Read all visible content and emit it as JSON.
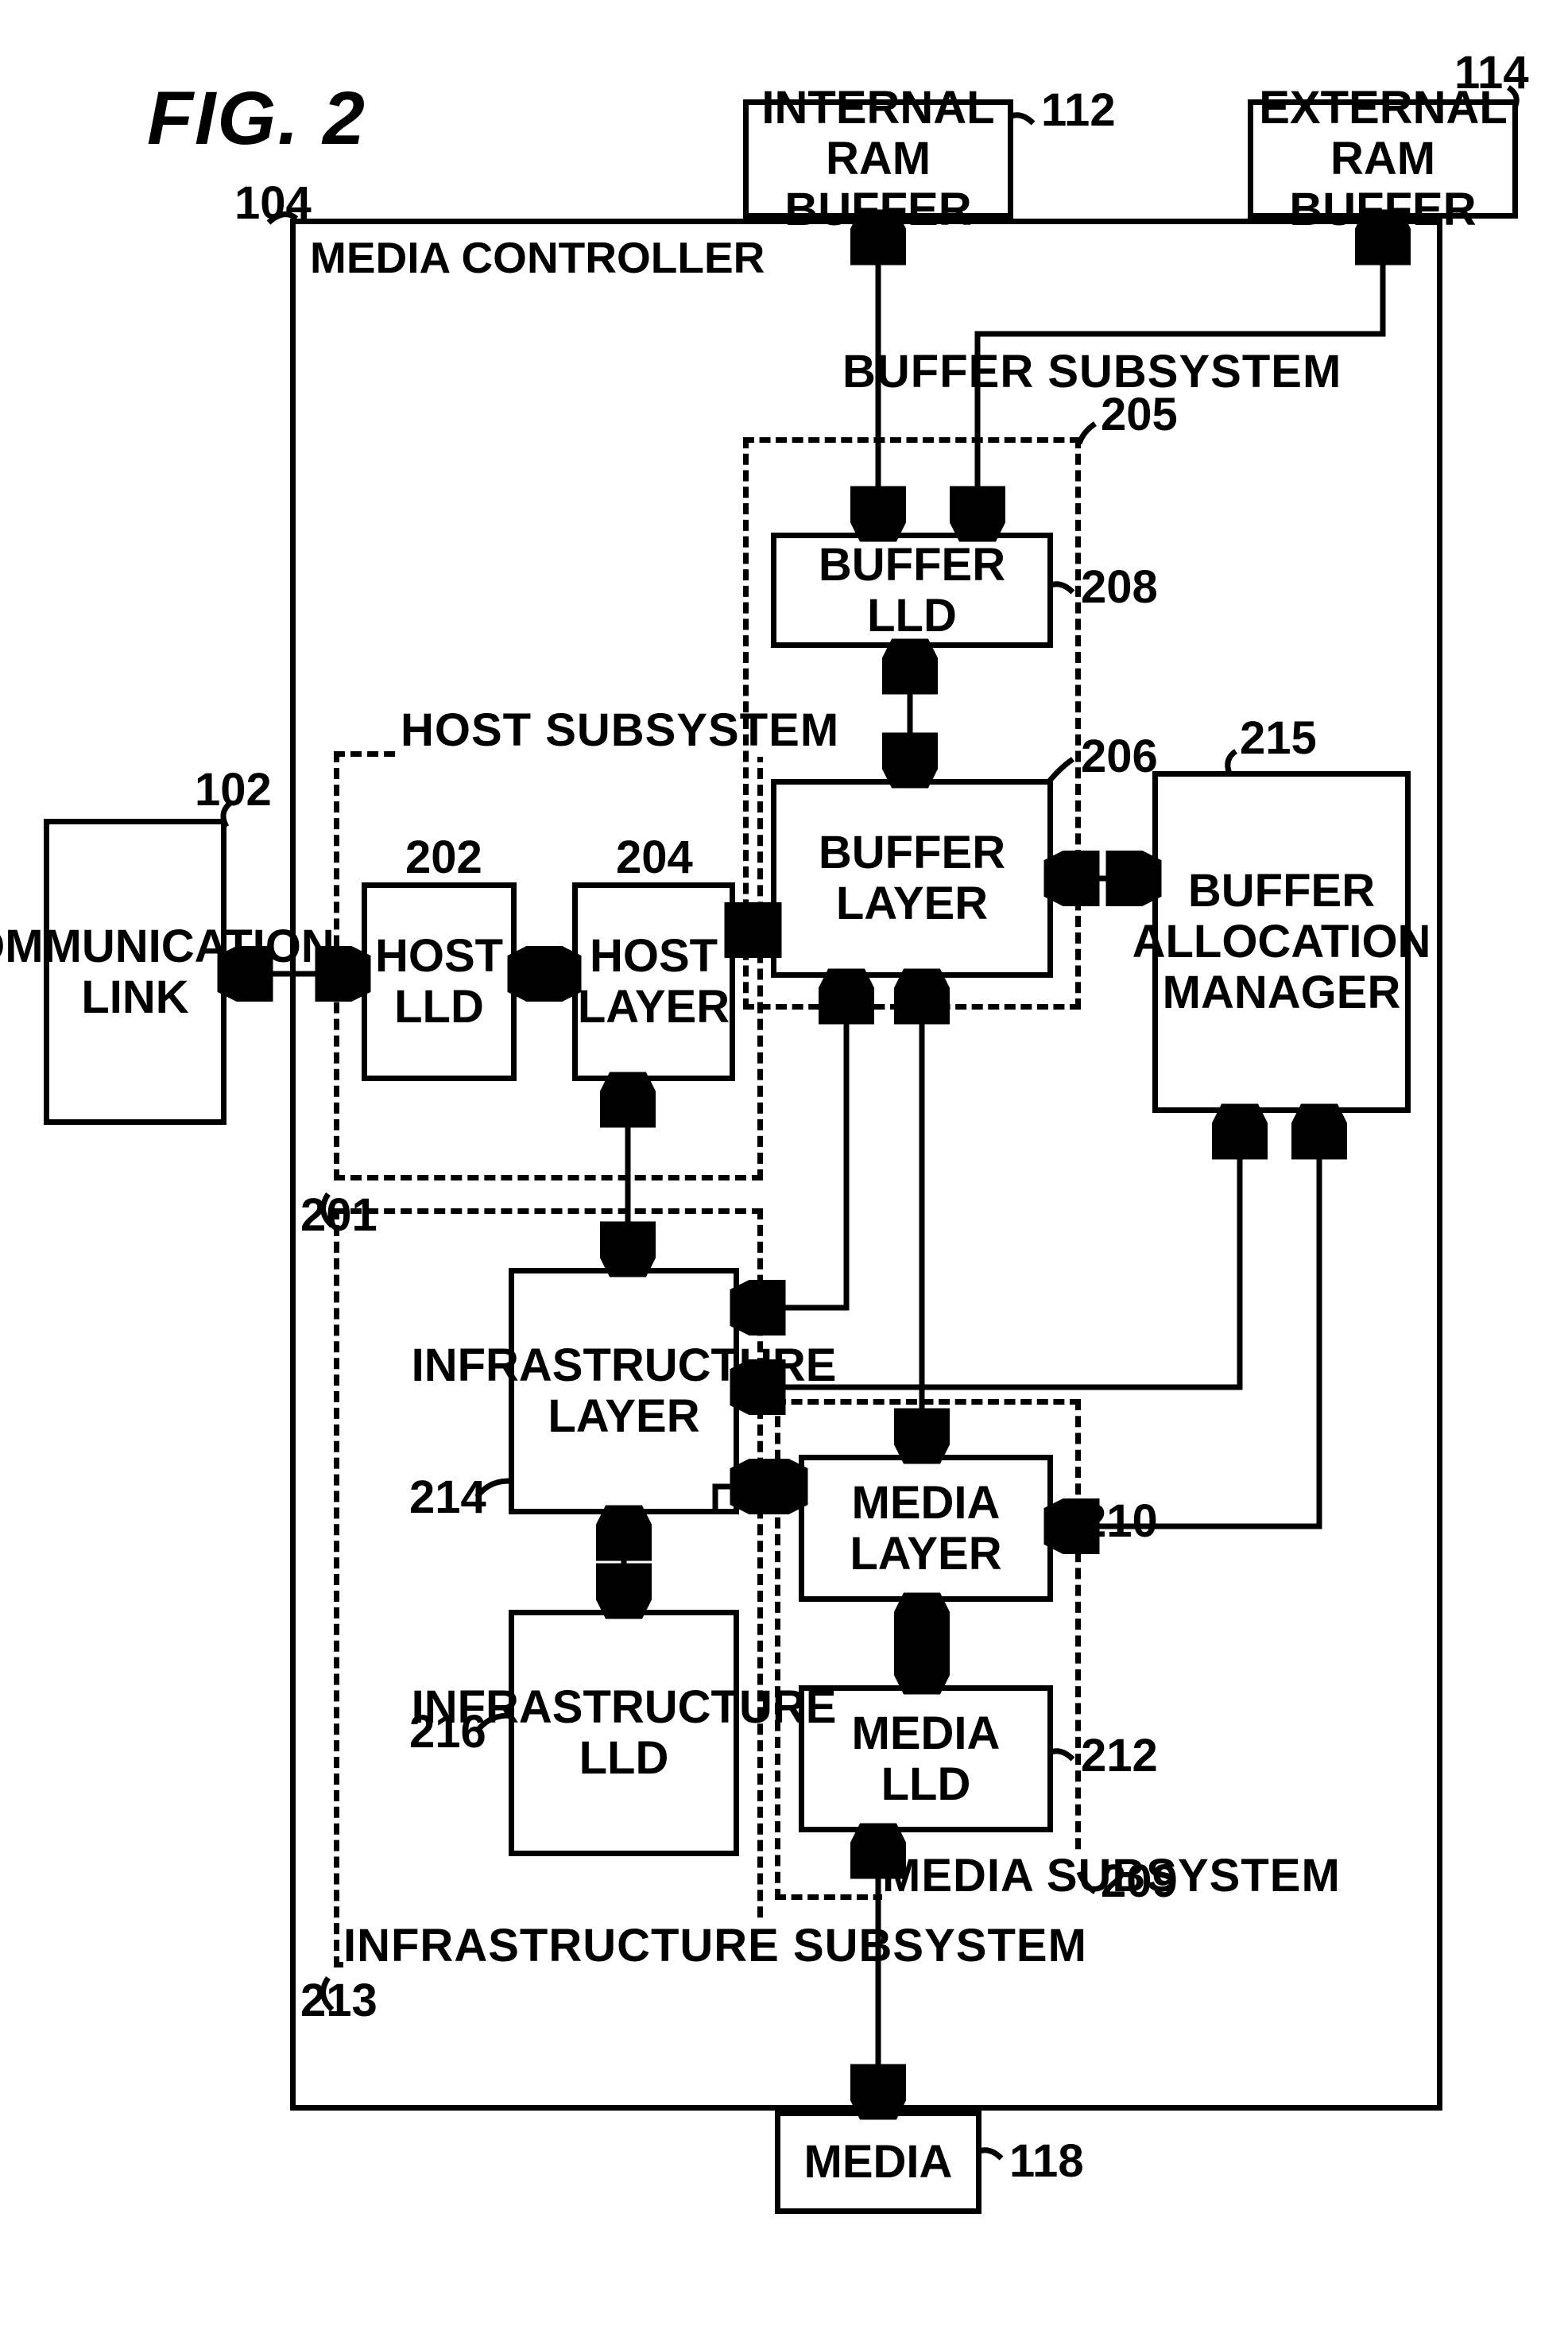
{
  "figure_title": "FIG. 2",
  "diagram": {
    "controller": {
      "label": "MEDIA CONTROLLER",
      "ref": "104"
    },
    "external_left": {
      "label": "COMMUNICATION LINK",
      "ref": "102"
    },
    "external_top_left": {
      "label": "INTERNAL RAM BUFFER",
      "ref": "112"
    },
    "external_top_right": {
      "label": "EXTERNAL RAM BUFFER",
      "ref": "114"
    },
    "external_bottom": {
      "label": "MEDIA",
      "ref": "118"
    },
    "subsystems": {
      "host": {
        "label": "HOST SUBSYSTEM",
        "ref": "201"
      },
      "buffer": {
        "label": "BUFFER SUBSYSTEM",
        "ref": "205"
      },
      "media": {
        "label": "MEDIA SUBSYSTEM",
        "ref": "209"
      },
      "infra": {
        "label": "INFRASTRUCTURE SUBSYSTEM",
        "ref": "213"
      }
    },
    "blocks": {
      "host_lld": {
        "label": "HOST LLD",
        "ref": "202"
      },
      "host_layer": {
        "label": "HOST LAYER",
        "ref": "204"
      },
      "buffer_lld": {
        "label": "BUFFER LLD",
        "ref": "208"
      },
      "buffer_layer": {
        "label": "BUFFER LAYER",
        "ref": "206"
      },
      "buffer_alloc": {
        "label": "BUFFER ALLOCATION MANAGER",
        "ref": "215"
      },
      "media_layer": {
        "label": "MEDIA LAYER",
        "ref": "210"
      },
      "media_lld": {
        "label": "MEDIA LLD",
        "ref": "212"
      },
      "infra_layer": {
        "label": "INFRASTRUCTURE LAYER",
        "ref": "214"
      },
      "infra_lld": {
        "label": "INFRASTRUCTURE LLD",
        "ref": "216"
      }
    }
  },
  "chart_data": {
    "type": "block-diagram",
    "title": "FIG. 2 — Media Controller architecture",
    "components": [
      {
        "id": "104",
        "name": "MEDIA CONTROLLER",
        "kind": "container"
      },
      {
        "id": "102",
        "name": "COMMUNICATION LINK",
        "kind": "external"
      },
      {
        "id": "112",
        "name": "INTERNAL RAM BUFFER",
        "kind": "external"
      },
      {
        "id": "114",
        "name": "EXTERNAL RAM BUFFER",
        "kind": "external"
      },
      {
        "id": "118",
        "name": "MEDIA",
        "kind": "external"
      },
      {
        "id": "201",
        "name": "HOST SUBSYSTEM",
        "kind": "subsystem"
      },
      {
        "id": "205",
        "name": "BUFFER SUBSYSTEM",
        "kind": "subsystem"
      },
      {
        "id": "209",
        "name": "MEDIA SUBSYSTEM",
        "kind": "subsystem"
      },
      {
        "id": "213",
        "name": "INFRASTRUCTURE SUBSYSTEM",
        "kind": "subsystem"
      },
      {
        "id": "202",
        "name": "HOST LLD",
        "kind": "block",
        "parent": "201"
      },
      {
        "id": "204",
        "name": "HOST LAYER",
        "kind": "block",
        "parent": "201"
      },
      {
        "id": "208",
        "name": "BUFFER LLD",
        "kind": "block",
        "parent": "205"
      },
      {
        "id": "206",
        "name": "BUFFER LAYER",
        "kind": "block",
        "parent": "205"
      },
      {
        "id": "215",
        "name": "BUFFER ALLOCATION MANAGER",
        "kind": "block"
      },
      {
        "id": "210",
        "name": "MEDIA LAYER",
        "kind": "block",
        "parent": "209"
      },
      {
        "id": "212",
        "name": "MEDIA LLD",
        "kind": "block",
        "parent": "209"
      },
      {
        "id": "214",
        "name": "INFRASTRUCTURE LAYER",
        "kind": "block",
        "parent": "213"
      },
      {
        "id": "216",
        "name": "INFRASTRUCTURE LLD",
        "kind": "block",
        "parent": "213"
      }
    ],
    "edges": [
      {
        "a": "102",
        "b": "202",
        "dir": "both"
      },
      {
        "a": "202",
        "b": "204",
        "dir": "both"
      },
      {
        "a": "204",
        "b": "206",
        "dir": "both"
      },
      {
        "a": "204",
        "b": "214",
        "dir": "both"
      },
      {
        "a": "206",
        "b": "208",
        "dir": "both"
      },
      {
        "a": "208",
        "b": "112",
        "dir": "both"
      },
      {
        "a": "208",
        "b": "114",
        "dir": "both",
        "via": "104-edge"
      },
      {
        "a": "206",
        "b": "215",
        "dir": "both"
      },
      {
        "a": "206",
        "b": "214",
        "dir": "both"
      },
      {
        "a": "206",
        "b": "210",
        "dir": "both"
      },
      {
        "a": "210",
        "b": "212",
        "dir": "both"
      },
      {
        "a": "210",
        "b": "214",
        "dir": "both"
      },
      {
        "a": "210",
        "b": "215",
        "dir": "both"
      },
      {
        "a": "212",
        "b": "118",
        "dir": "both"
      },
      {
        "a": "214",
        "b": "215",
        "dir": "both"
      },
      {
        "a": "214",
        "b": "216",
        "dir": "both"
      }
    ]
  }
}
